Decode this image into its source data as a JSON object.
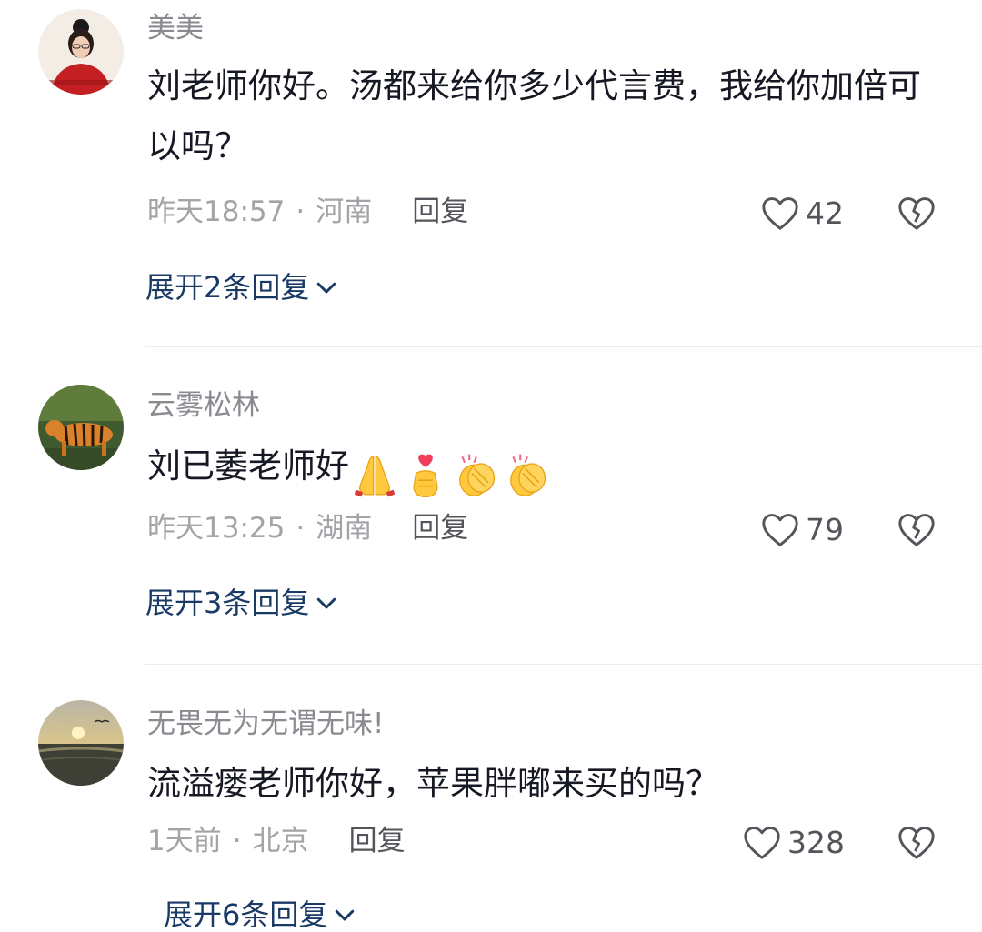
{
  "comments": [
    {
      "username": "美美",
      "content": "刘老师你好。汤都来给你多少代言费，我给你加倍可以吗？",
      "time": "昨天18:57",
      "location": "河南",
      "reply_label": "回复",
      "likes": "42",
      "expand_label": "展开2条回复"
    },
    {
      "username": "云雾松林",
      "content": "刘已萎老师好",
      "emojis": [
        "folded-hands-emoji",
        "finger-heart-emoji",
        "clapping-hands-emoji",
        "clapping-hands-emoji"
      ],
      "time": "昨天13:25",
      "location": "湖南",
      "reply_label": "回复",
      "likes": "79",
      "expand_label": "展开3条回复"
    },
    {
      "username": "无畏无为无谓无味!",
      "content": "流溢瘘老师你好，苹果胖嘟来买的吗？",
      "time": "1天前",
      "location": "北京",
      "reply_label": "回复",
      "likes": "328",
      "expand_label": "展开6条回复"
    }
  ],
  "separator": "·",
  "colors": {
    "username": "#8a8b91",
    "content": "#161823",
    "meta": "#a3a3a8",
    "expand_link": "#1a3a66",
    "divider": "#ececee"
  }
}
